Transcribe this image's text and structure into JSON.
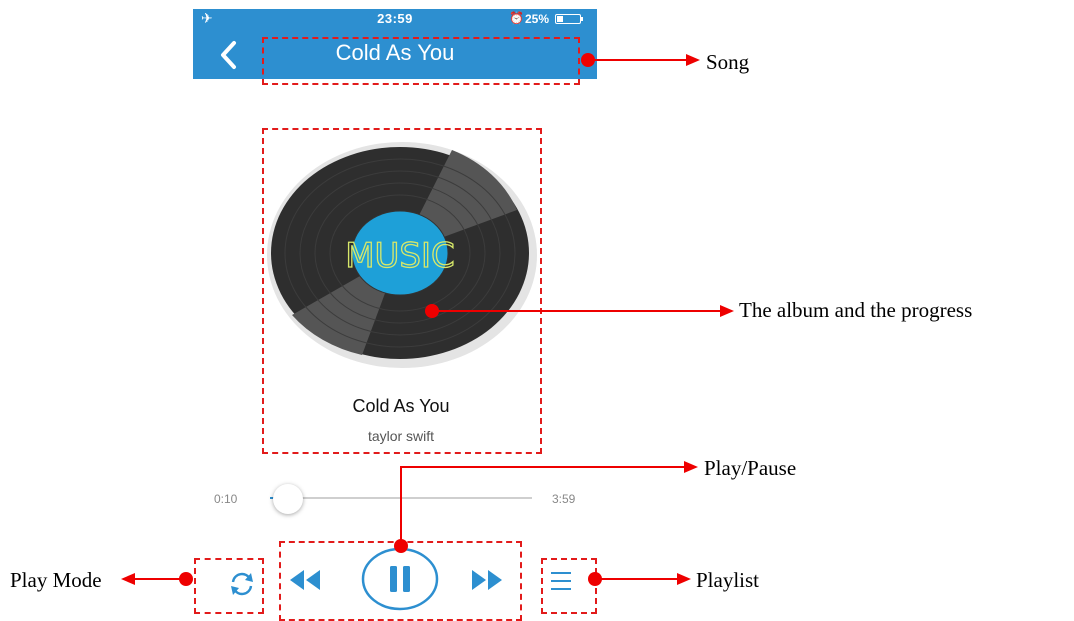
{
  "status_bar": {
    "airplane_icon": "airplane-icon",
    "time": "23:59",
    "alarm_icon": "alarm-icon",
    "battery_percent": "25%",
    "battery_level": 0.25
  },
  "nav": {
    "back_icon": "chevron-left-icon",
    "title": "Cold As You"
  },
  "album": {
    "art_text": "MUSIC",
    "song_title": "Cold As You",
    "artist": "taylor swift"
  },
  "progress": {
    "elapsed": "0:10",
    "total": "3:59",
    "fraction": 0.04
  },
  "controls": {
    "play_mode_icon": "repeat-icon",
    "previous_icon": "rewind-icon",
    "play_pause_icon": "pause-icon",
    "next_icon": "fast-forward-icon",
    "playlist_icon": "list-icon"
  },
  "annotations": {
    "song": "Song",
    "album_progress": "The  album  and  the  progress",
    "play_pause": "Play/Pause",
    "play_mode": "Play Mode",
    "playlist": "Playlist"
  },
  "colors": {
    "accent": "#2d8fd0",
    "annotation_red": "#e21b1b",
    "record_dark": "#2e2e2e",
    "record_label": "#1ea0d8",
    "label_text": "#d7e86a"
  }
}
